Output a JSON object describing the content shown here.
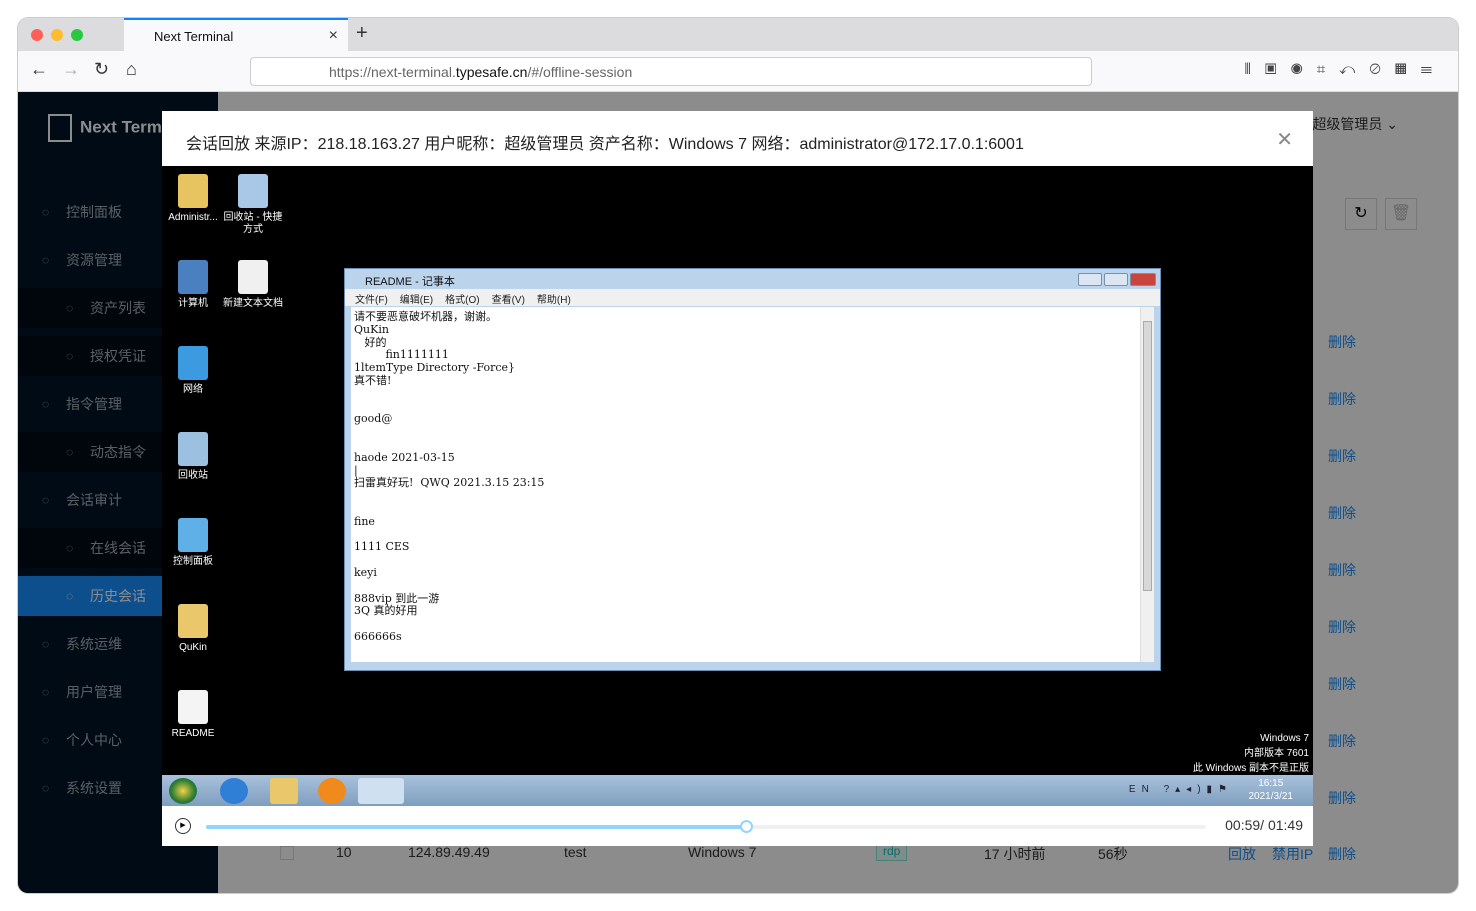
{
  "browser": {
    "tab_title": "Next Terminal",
    "url_prefix": "https://next-terminal.",
    "url_domain": "typesafe.cn",
    "url_path": "/#/offline-session"
  },
  "app": {
    "logo": "Next Terminal",
    "user": "超级管理员"
  },
  "sidebar": {
    "items": [
      {
        "label": "控制面板",
        "icon": "dashboard-icon"
      },
      {
        "label": "资源管理",
        "icon": "cloud-icon"
      },
      {
        "label": "资产列表",
        "icon": "desktop-icon",
        "sub": true
      },
      {
        "label": "授权凭证",
        "icon": "idcard-icon",
        "sub": true
      },
      {
        "label": "指令管理",
        "icon": "code-icon"
      },
      {
        "label": "动态指令",
        "icon": "block-icon",
        "sub": true
      },
      {
        "label": "会话审计",
        "icon": "audit-icon"
      },
      {
        "label": "在线会话",
        "icon": "link-icon",
        "sub": true
      },
      {
        "label": "历史会话",
        "icon": "disconnect-icon",
        "sub": true,
        "active": true
      },
      {
        "label": "系统运维",
        "icon": "ops-icon"
      },
      {
        "label": "用户管理",
        "icon": "user-icon"
      },
      {
        "label": "个人中心",
        "icon": "profile-icon"
      },
      {
        "label": "系统设置",
        "icon": "setting-icon"
      }
    ]
  },
  "table": {
    "delete_label": "删除",
    "last_row": {
      "index": "10",
      "ip": "124.89.49.49",
      "user": "test",
      "asset": "Windows 7",
      "protocol": "rdp",
      "time": "17 小时前",
      "duration": "56秒",
      "replay": "回放",
      "ban": "禁用IP",
      "delete": "删除"
    }
  },
  "modal": {
    "title": "会话回放 来源IP：218.18.163.27 用户昵称：超级管理员 资产名称：Windows 7 网络：administrator@172.17.0.1:6001"
  },
  "desktop": {
    "icons": [
      "Administr...",
      "回收站 - 快捷方式",
      "计算机",
      "新建文本文档",
      "网络",
      "回收站",
      "控制面板",
      "QuKin",
      "README"
    ],
    "notepad": {
      "title": "README - 记事本",
      "menu": [
        "文件(F)",
        "编辑(E)",
        "格式(O)",
        "查看(V)",
        "帮助(H)"
      ],
      "text": "请不要恶意破坏机器，谢谢。\nQuKin\n   好的\n         fin1111111\n1ltemType Directory -Force}\n真不错!\n\n\ngood@\n\n\nhaode 2021-03-15\n|\n扫雷真好玩!  QWQ 2021.3.15 23:15\n\n\nfine\n\n1111 CES\n\nkeyi\n\n888vip 到此一游\n3Q 真的好用\n\n666666s"
    },
    "watermark": [
      "Windows 7",
      "内部版本 7601",
      "此 Windows 副本不是正版"
    ],
    "tray": {
      "lang": "EN",
      "time": "16:15",
      "date": "2021/3/21"
    }
  },
  "player": {
    "current": "00:59",
    "total": "01:49",
    "time_label": "00:59/ 01:49",
    "progress": 0.54
  }
}
